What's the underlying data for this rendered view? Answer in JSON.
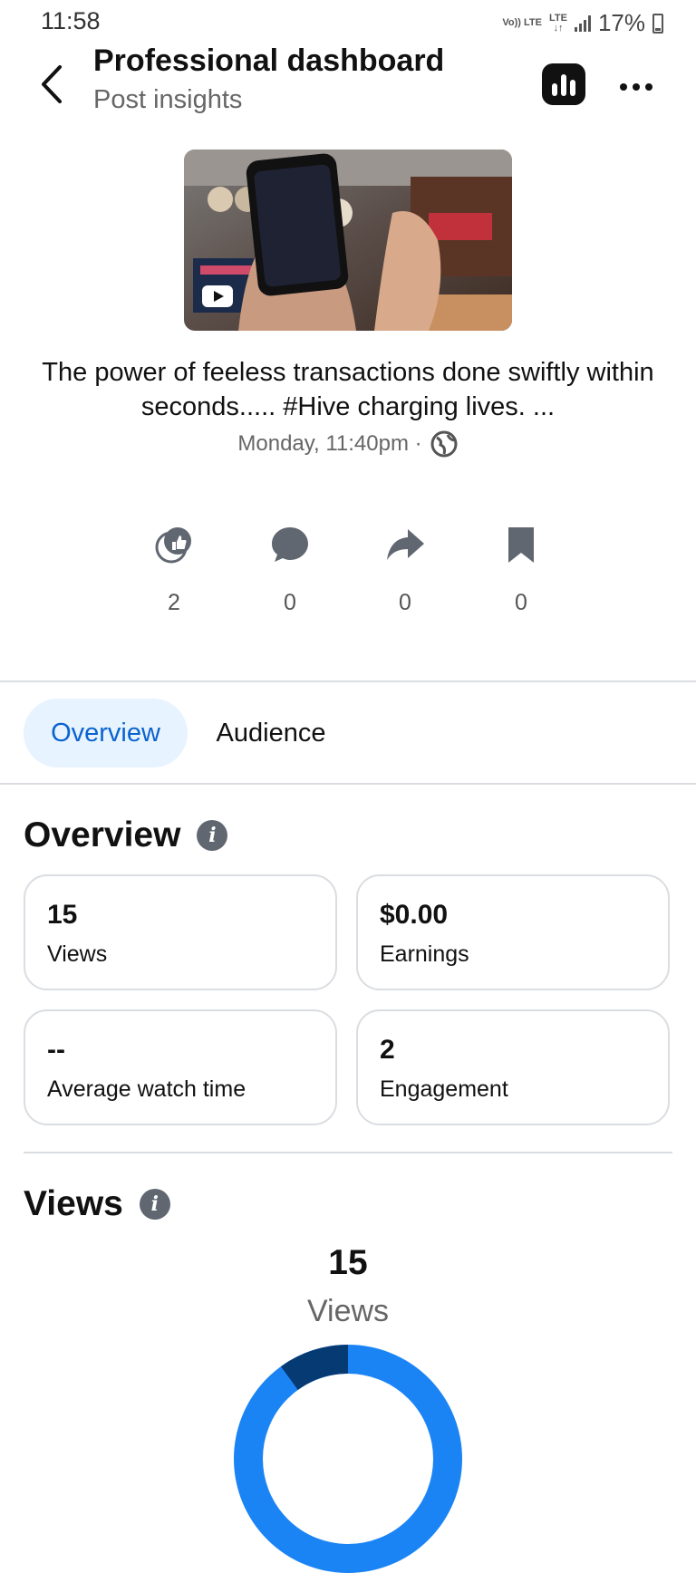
{
  "status_bar": {
    "time": "11:58",
    "network": "Vo)) LTE",
    "network2": "LTE",
    "battery": "17%"
  },
  "header": {
    "title": "Professional dashboard",
    "subtitle": "Post insights"
  },
  "post": {
    "caption": "The power of feeless transactions done swiftly within seconds..... #Hive charging lives. ...",
    "date": "Monday, 11:40pm ·"
  },
  "engagement": {
    "reactions": "2",
    "comments": "0",
    "shares": "0",
    "saves": "0"
  },
  "tabs": [
    {
      "label": "Overview",
      "active": true
    },
    {
      "label": "Audience",
      "active": false
    }
  ],
  "overview": {
    "title": "Overview",
    "cards": [
      {
        "value": "15",
        "label": "Views"
      },
      {
        "value": "$0.00",
        "label": "Earnings"
      },
      {
        "value": "--",
        "label": "Average watch time"
      },
      {
        "value": "2",
        "label": "Engagement"
      }
    ]
  },
  "views": {
    "title": "Views",
    "total": "15",
    "label": "Views",
    "donut_fraction_dark": 0.1,
    "color_main": "#1b84f5",
    "color_dark": "#063a73"
  },
  "colors": {
    "accent": "#0b63ce",
    "tab_active_bg": "#e7f3ff"
  }
}
